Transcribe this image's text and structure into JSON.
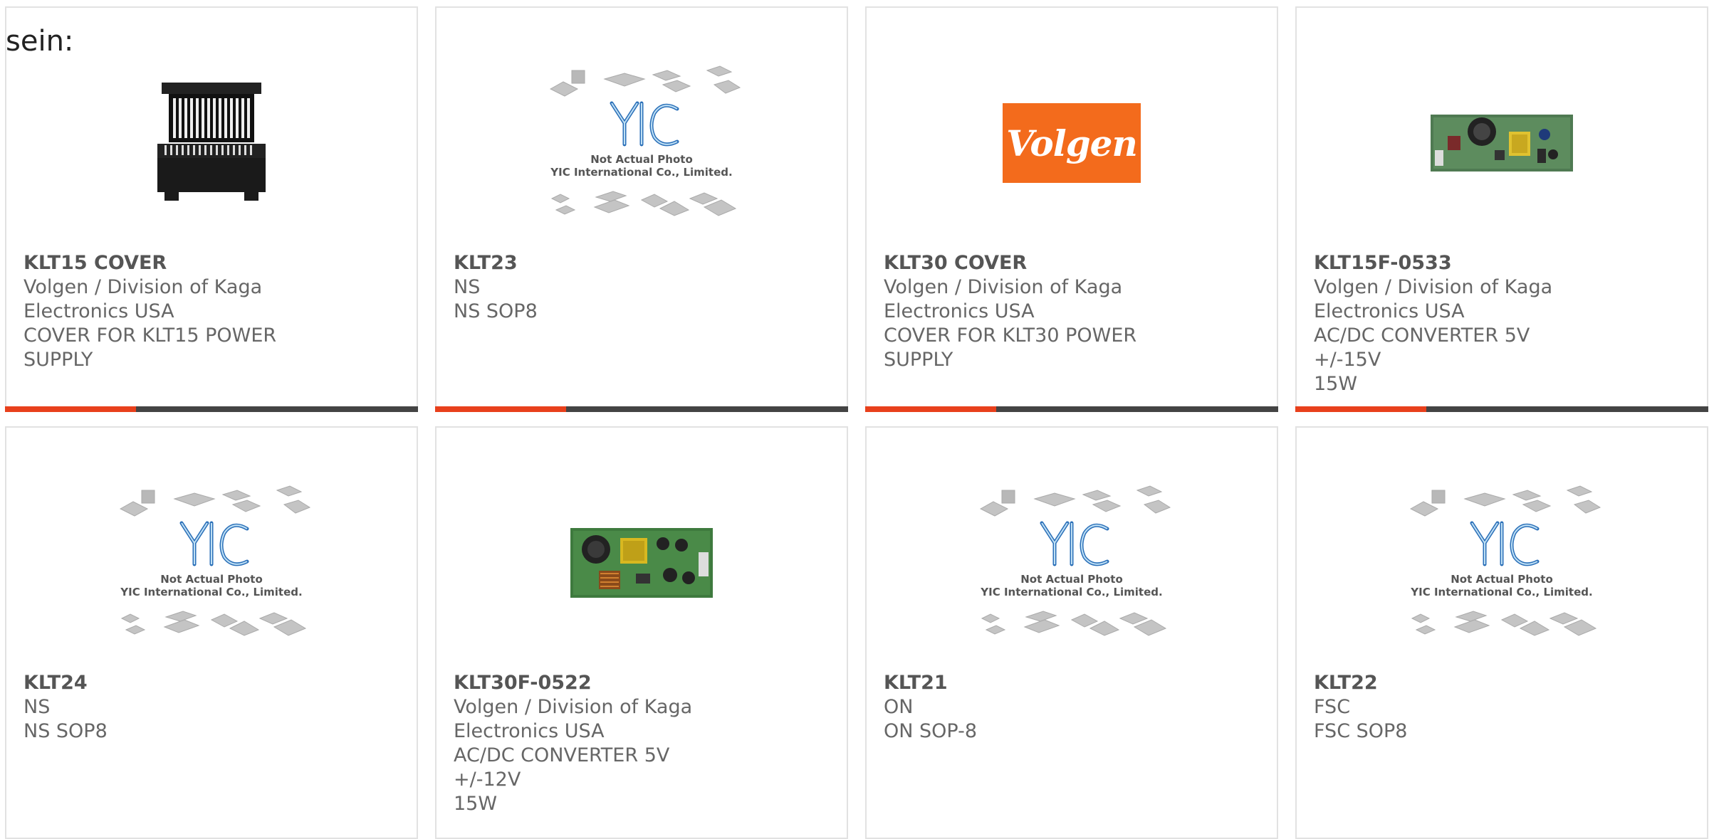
{
  "lead_text": "sein:",
  "placeholder": {
    "line1": "Not Actual Photo",
    "line2": "YIC International Co., Limited."
  },
  "brand_logo_text": "Volgen",
  "colors": {
    "accent": "#e8401c",
    "bar": "#444444",
    "border": "#e2e2e2",
    "text": "#666666"
  },
  "products": [
    {
      "part": "KLT15 COVER",
      "mfr_line1": "Volgen / Division of Kaga",
      "mfr_line2": "Electronics USA",
      "desc_line1": "COVER FOR KLT15 POWER",
      "desc_line2": "SUPPLY",
      "image": "cover-photo"
    },
    {
      "part": "KLT23",
      "mfr_line1": "NS",
      "mfr_line2": "",
      "desc_line1": "NS SOP8",
      "desc_line2": "",
      "image": "not-actual-photo"
    },
    {
      "part": "KLT30 COVER",
      "mfr_line1": "Volgen / Division of Kaga",
      "mfr_line2": "Electronics USA",
      "desc_line1": "COVER FOR KLT30 POWER",
      "desc_line2": "SUPPLY",
      "image": "volgen-logo"
    },
    {
      "part": "KLT15F-0533",
      "mfr_line1": "Volgen / Division of Kaga",
      "mfr_line2": "Electronics USA",
      "desc_line1": "AC/DC CONVERTER 5V +/-15V",
      "desc_line2": "15W",
      "image": "pcb-photo"
    },
    {
      "part": "KLT24",
      "mfr_line1": "NS",
      "mfr_line2": "",
      "desc_line1": "NS SOP8",
      "desc_line2": "",
      "image": "not-actual-photo"
    },
    {
      "part": "KLT30F-0522",
      "mfr_line1": "Volgen / Division of Kaga",
      "mfr_line2": "Electronics USA",
      "desc_line1": "AC/DC CONVERTER 5V +/-12V",
      "desc_line2": "15W",
      "image": "pcb-photo"
    },
    {
      "part": "KLT21",
      "mfr_line1": "ON",
      "mfr_line2": "",
      "desc_line1": "ON SOP-8",
      "desc_line2": "",
      "image": "not-actual-photo"
    },
    {
      "part": "KLT22",
      "mfr_line1": "FSC",
      "mfr_line2": "",
      "desc_line1": "FSC SOP8",
      "desc_line2": "",
      "image": "not-actual-photo"
    }
  ]
}
